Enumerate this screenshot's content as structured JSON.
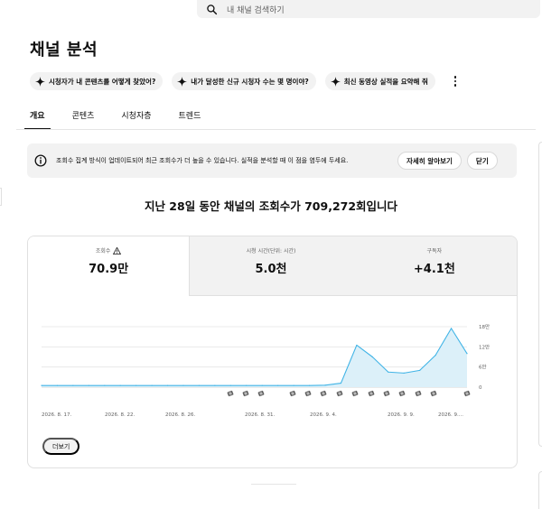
{
  "search": {
    "placeholder": "내 채널 검색하기"
  },
  "page_title": "채널 분석",
  "chips": [
    "시청자가 내 콘텐츠를 어떻게 찾았어?",
    "내가 달성한 신규 시청자 수는 몇 명이야?",
    "최신 동영상 실적을 요약해 줘"
  ],
  "tabs": [
    "개요",
    "콘텐츠",
    "시청자층",
    "트렌드"
  ],
  "notice": {
    "text": "조회수 집계 방식이 업데이트되어 최근 조회수가 더 높을 수 있습니다. 실적을 분석할 때 이 점을 염두에 두세요.",
    "learn_more": "자세히 알아보기",
    "close": "닫기"
  },
  "headline": "지난 28일 동안 채널의 조회수가 709,272회입니다",
  "metrics": [
    {
      "label": "조회수",
      "value": "70.9만",
      "warning": true
    },
    {
      "label": "시청 시간(단위: 시간)",
      "value": "5.0천"
    },
    {
      "label": "구독자",
      "value": "+4.1천"
    }
  ],
  "more_label": "더보기",
  "colors": {
    "line": "#41b4e6",
    "fill": "#dcf0f9",
    "grid": "#e5e5e5"
  },
  "chart_data": {
    "type": "area",
    "x_tick_labels": [
      "2026. 8. 17.",
      "2026. 8. 22.",
      "2026. 8. 26.",
      "2026. 8. 31.",
      "2026. 9. 4.",
      "2026. 9. 9.",
      "2026. 9...."
    ],
    "y_tick_labels": [
      "18만",
      "12만",
      "6만",
      "0"
    ],
    "ylim": [
      0,
      180000
    ],
    "values": [
      5000,
      5000,
      5000,
      5000,
      5000,
      5000,
      5000,
      5000,
      5000,
      5000,
      5000,
      5000,
      5000,
      5000,
      5000,
      5000,
      5000,
      5000,
      6000,
      12000,
      125000,
      90000,
      45000,
      42000,
      50000,
      95000,
      175000,
      100000
    ],
    "markers": [
      "s",
      "s",
      "s",
      "s",
      "s",
      "s",
      "s",
      "s",
      "s",
      "s",
      "s",
      "s",
      "s",
      "s",
      "s"
    ],
    "grid": true
  }
}
